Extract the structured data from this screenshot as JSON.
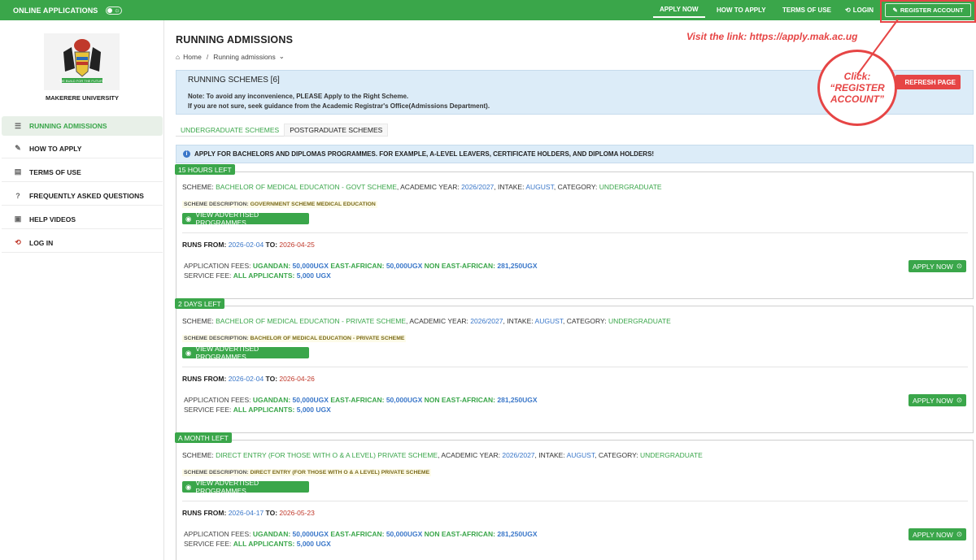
{
  "topbar": {
    "brand": "ONLINE APPLICATIONS",
    "nav": [
      "APPLY NOW",
      "HOW TO APPLY",
      "TERMS OF USE",
      "LOGIN"
    ],
    "register": "REGISTER ACCOUNT"
  },
  "sidebar": {
    "university": "MAKERERE UNIVERSITY",
    "items": [
      {
        "label": "RUNNING ADMISSIONS",
        "icon": "list-icon"
      },
      {
        "label": "HOW TO APPLY",
        "icon": "edit-icon"
      },
      {
        "label": "TERMS OF USE",
        "icon": "document-icon"
      },
      {
        "label": "FREQUENTLY ASKED QUESTIONS",
        "icon": "question-icon"
      },
      {
        "label": "HELP VIDEOS",
        "icon": "video-icon"
      },
      {
        "label": "LOG IN",
        "icon": "login-icon"
      }
    ]
  },
  "main": {
    "title": "RUNNING ADMISSIONS",
    "breadcrumb": {
      "home": "Home",
      "current": "Running admissions"
    },
    "annotation_link": "Visit the link: https://apply.mak.ac.ug",
    "annotation_click": [
      "Click:",
      "“REGISTER",
      "ACCOUNT”"
    ],
    "schemes_header": "RUNNING SCHEMES [6]",
    "note_line1": "Note: To avoid any inconvenience, PLEASE Apply to the Right Scheme.",
    "note_line2": "If you are not sure, seek guidance from the Academic Registrar's Office(Admissions Department).",
    "refresh": "REFRESH PAGE",
    "tabs": [
      "UNDERGRADUATE SCHEMES",
      "POSTGRADUATE SCHEMES"
    ],
    "info": "APPLY FOR BACHELORS AND DIPLOMAS PROGRAMMES. FOR EXAMPLE, A-LEVEL LEAVERS, CERTIFICATE HOLDERS, AND DIPLOMA HOLDERS!"
  },
  "labels": {
    "scheme": "SCHEME:",
    "academic_year": "ACADEMIC YEAR:",
    "intake": "INTAKE:",
    "category": "CATEGORY:",
    "scheme_description": "SCHEME DESCRIPTION:",
    "view_programmes": "VIEW ADVERTISED PROGRAMMES",
    "runs_from": "RUNS FROM:",
    "to": "TO:",
    "application_fees": "APPLICATION FEES:",
    "ugandan": "UGANDAN:",
    "east_african": "EAST-AFRICAN:",
    "non_east_african": "NON EAST-AFRICAN:",
    "service_fee": "SERVICE FEE:",
    "all_applicants": "ALL APPLICANTS:",
    "apply_now": "APPLY NOW"
  },
  "cards": [
    {
      "time_left": "15 HOURS LEFT",
      "scheme": "BACHELOR OF MEDICAL EDUCATION - GOVT SCHEME",
      "academic_year": "2026/2027",
      "intake": "AUGUST",
      "category": "UNDERGRADUATE",
      "description": "GOVERNMENT SCHEME MEDICAL EDUCATION",
      "runs_from": "2026-02-04",
      "runs_to": "2026-04-25",
      "fee_ugandan": "50,000UGX",
      "fee_east_african": "50,000UGX",
      "fee_non_east_african": "281,250UGX",
      "service_fee": "5,000 UGX"
    },
    {
      "time_left": "2 DAYS LEFT",
      "scheme": "BACHELOR OF MEDICAL EDUCATION - PRIVATE SCHEME",
      "academic_year": "2026/2027",
      "intake": "AUGUST",
      "category": "UNDERGRADUATE",
      "description": "BACHELOR OF MEDICAL EDUCATION - PRIVATE SCHEME",
      "runs_from": "2026-02-04",
      "runs_to": "2026-04-26",
      "fee_ugandan": "50,000UGX",
      "fee_east_african": "50,000UGX",
      "fee_non_east_african": "281,250UGX",
      "service_fee": "5,000 UGX"
    },
    {
      "time_left": "A MONTH LEFT",
      "scheme": "DIRECT ENTRY (FOR THOSE WITH O & A LEVEL) PRIVATE SCHEME",
      "academic_year": "2026/2027",
      "intake": "AUGUST",
      "category": "UNDERGRADUATE",
      "description": "DIRECT ENTRY (FOR THOSE WITH O & A LEVEL) PRIVATE SCHEME",
      "runs_from": "2026-04-17",
      "runs_to": "2026-05-23",
      "fee_ugandan": "50,000UGX",
      "fee_east_african": "50,000UGX",
      "fee_non_east_african": "281,250UGX",
      "service_fee": "5,000 UGX"
    }
  ],
  "colors": {
    "brand_green": "#3aa64a",
    "link_blue": "#3a77c9",
    "annotation_red": "#e64545",
    "date_red": "#c0392b"
  }
}
